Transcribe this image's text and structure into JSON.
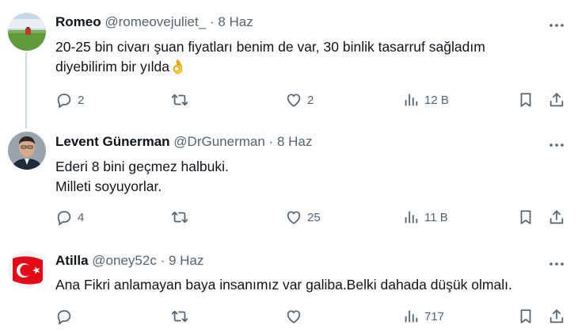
{
  "tweets": [
    {
      "name": "Romeo",
      "handle": "@romeovejuliet_",
      "dot": "·",
      "date": "8 Haz",
      "lines": [
        "20-25 bin civarı şuan fiyatları benim de var, 30 binlik tasarruf sağladım",
        "diyebilirim bir yılda👌"
      ],
      "replies": "2",
      "retweets": "",
      "likes": "2",
      "views": "12 B"
    },
    {
      "name": "Levent Günerman",
      "handle": "@DrGunerman",
      "dot": "·",
      "date": "8 Haz",
      "lines": [
        "Ederi 8 bini geçmez halbuki.",
        "Milleti soyuyorlar."
      ],
      "replies": "4",
      "retweets": "",
      "likes": "25",
      "views": "11 B"
    },
    {
      "name": "Atilla",
      "handle": "@oney52c",
      "dot": "·",
      "date": "9 Haz",
      "lines": [
        "Ana Fikri anlamayan baya insanımız var galiba.Belki dahada düşük olmalı."
      ],
      "replies": "",
      "retweets": "",
      "likes": "",
      "views": "717"
    }
  ],
  "icons": {
    "more": "more-icon",
    "reply": "reply-icon",
    "retweet": "retweet-icon",
    "like": "like-icon",
    "views": "views-icon",
    "bookmark": "bookmark-icon",
    "share": "share-icon"
  },
  "colors": {
    "text": "#0f1419",
    "secondary": "#536471",
    "thread_line": "#cfd9de"
  }
}
